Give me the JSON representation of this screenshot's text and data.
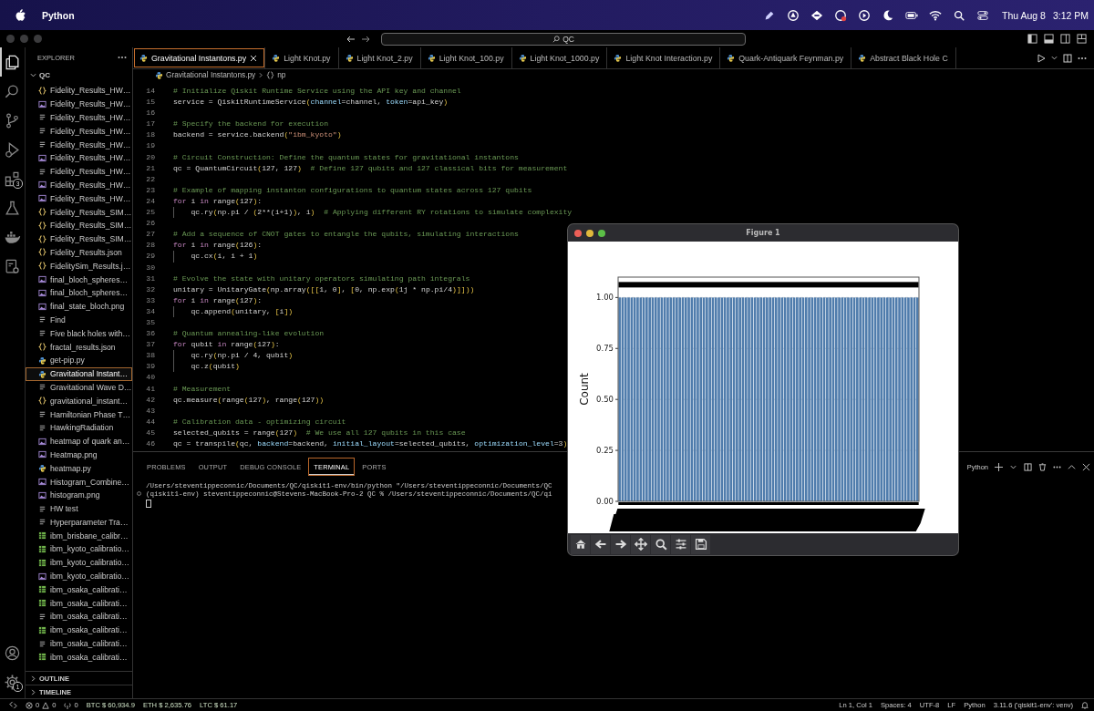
{
  "menubar": {
    "app": "Python",
    "date": "Thu Aug 8",
    "time": "3:12 PM"
  },
  "titlebar": {
    "search": "QC"
  },
  "activity_bar": {
    "items": [
      {
        "kind": "explorer",
        "selected": true
      },
      {
        "kind": "search",
        "selected": false
      },
      {
        "kind": "source_control",
        "selected": false
      },
      {
        "kind": "run",
        "selected": false
      },
      {
        "kind": "extensions",
        "selected": false,
        "badge": "3"
      },
      {
        "kind": "testing",
        "selected": false
      },
      {
        "kind": "docker",
        "selected": false
      },
      {
        "kind": "remote",
        "selected": false
      }
    ],
    "bottom": [
      {
        "kind": "account"
      },
      {
        "kind": "settings",
        "badge": "1"
      }
    ]
  },
  "sidebar": {
    "title": "EXPLORER",
    "folder": "QC",
    "items": [
      {
        "label": "Fidelity_Results_HW…",
        "kind": "json",
        "selected": false
      },
      {
        "label": "Fidelity_Results_HW…",
        "kind": "image",
        "selected": false
      },
      {
        "label": "Fidelity_Results_HW…",
        "kind": "text",
        "selected": false
      },
      {
        "label": "Fidelity_Results_HW…",
        "kind": "text",
        "selected": false
      },
      {
        "label": "Fidelity_Results_HW…",
        "kind": "text",
        "selected": false
      },
      {
        "label": "Fidelity_Results_HW…",
        "kind": "image",
        "selected": false
      },
      {
        "label": "Fidelity_Results_HW…",
        "kind": "text",
        "selected": false
      },
      {
        "label": "Fidelity_Results_HW…",
        "kind": "image",
        "selected": false
      },
      {
        "label": "Fidelity_Results_HW…",
        "kind": "image",
        "selected": false
      },
      {
        "label": "Fidelity_Results_SIM…",
        "kind": "json",
        "selected": false
      },
      {
        "label": "Fidelity_Results_SIM…",
        "kind": "json",
        "selected": false
      },
      {
        "label": "Fidelity_Results_SIM…",
        "kind": "json",
        "selected": false
      },
      {
        "label": "Fidelity_Results.json",
        "kind": "json",
        "selected": false
      },
      {
        "label": "FidelitySim_Results.j…",
        "kind": "json",
        "selected": false
      },
      {
        "label": "final_bloch_spheres…",
        "kind": "image",
        "selected": false
      },
      {
        "label": "final_bloch_spheres…",
        "kind": "image",
        "selected": false
      },
      {
        "label": "final_state_bloch.png",
        "kind": "image",
        "selected": false
      },
      {
        "label": "Find",
        "kind": "text",
        "selected": false
      },
      {
        "label": "Five black holes with…",
        "kind": "text",
        "selected": false
      },
      {
        "label": "fractal_results.json",
        "kind": "json",
        "selected": false
      },
      {
        "label": "get-pip.py",
        "kind": "python",
        "selected": false
      },
      {
        "label": "Gravitational Instant…",
        "kind": "python",
        "selected": true
      },
      {
        "label": "Gravitational Wave D…",
        "kind": "text",
        "selected": false
      },
      {
        "label": "gravitational_instant…",
        "kind": "json",
        "selected": false
      },
      {
        "label": "Hamiltonian Phase T…",
        "kind": "text",
        "selected": false
      },
      {
        "label": "HawkingRadiation",
        "kind": "text",
        "selected": false
      },
      {
        "label": "heatmap of quark an…",
        "kind": "image",
        "selected": false
      },
      {
        "label": "Heatmap.png",
        "kind": "image",
        "selected": false
      },
      {
        "label": "heatmap.py",
        "kind": "python",
        "selected": false
      },
      {
        "label": "Histogram_Combine…",
        "kind": "image",
        "selected": false
      },
      {
        "label": "histogram.png",
        "kind": "image",
        "selected": false
      },
      {
        "label": "HW test",
        "kind": "text",
        "selected": false
      },
      {
        "label": "Hyperparameter Tra…",
        "kind": "text",
        "selected": false
      },
      {
        "label": "ibm_brisbane_calibr…",
        "kind": "table",
        "selected": false
      },
      {
        "label": "ibm_kyoto_calibratio…",
        "kind": "table",
        "selected": false
      },
      {
        "label": "ibm_kyoto_calibratio…",
        "kind": "table",
        "selected": false
      },
      {
        "label": "ibm_kyoto_calibratio…",
        "kind": "image",
        "selected": false
      },
      {
        "label": "ibm_osaka_calibrati…",
        "kind": "table",
        "selected": false
      },
      {
        "label": "ibm_osaka_calibrati…",
        "kind": "table",
        "selected": false
      },
      {
        "label": "ibm_osaka_calibrati…",
        "kind": "text",
        "selected": false
      },
      {
        "label": "ibm_osaka_calibrati…",
        "kind": "table",
        "selected": false
      },
      {
        "label": "ibm_osaka_calibrati…",
        "kind": "text",
        "selected": false
      },
      {
        "label": "ibm_osaka_calibrati…",
        "kind": "table",
        "selected": false
      }
    ],
    "sections": [
      "OUTLINE",
      "TIMELINE"
    ]
  },
  "tabs": [
    {
      "label": "Gravitational Instantons.py",
      "selected": true
    },
    {
      "label": "Light Knot.py",
      "selected": false
    },
    {
      "label": "Light Knot_2.py",
      "selected": false
    },
    {
      "label": "Light Knot_100.py",
      "selected": false
    },
    {
      "label": "Light Knot_1000.py",
      "selected": false
    },
    {
      "label": "Light Knot Interaction.py",
      "selected": false
    },
    {
      "label": "Quark-Antiquark Feynman.py",
      "selected": false
    },
    {
      "label": "Abstract Black Hole C",
      "selected": false
    }
  ],
  "breadcrumb": {
    "file": "Gravitational Instantons.py",
    "symbol": "np"
  },
  "code": {
    "lines": [
      {
        "number": "14",
        "tokens": [
          {
            "text": "# Initialize Qiskit Runtime Service using the API key and channel",
            "kind": "comment"
          }
        ]
      },
      {
        "number": "15",
        "tokens": [
          {
            "text": "service = QiskitRuntimeService",
            "kind": "plain"
          },
          {
            "text": "(",
            "kind": "bracket"
          },
          {
            "text": "channel",
            "kind": "param"
          },
          {
            "text": "=channel, ",
            "kind": "plain"
          },
          {
            "text": "token",
            "kind": "param"
          },
          {
            "text": "=api_key",
            "kind": "plain"
          },
          {
            "text": ")",
            "kind": "bracket"
          }
        ]
      },
      {
        "number": "16"
      },
      {
        "number": "17",
        "tokens": [
          {
            "text": "# Specify the backend for execution",
            "kind": "comment"
          }
        ]
      },
      {
        "number": "18",
        "tokens": [
          {
            "text": "backend = service.backend",
            "kind": "plain"
          },
          {
            "text": "(",
            "kind": "bracket"
          },
          {
            "text": "\"ibm_kyoto\"",
            "kind": "string"
          },
          {
            "text": ")",
            "kind": "bracket"
          }
        ]
      },
      {
        "number": "19"
      },
      {
        "number": "20",
        "tokens": [
          {
            "text": "# Circuit Construction: Define the quantum states for gravitational instantons",
            "kind": "comment"
          }
        ]
      },
      {
        "number": "21",
        "tokens": [
          {
            "text": "qc = QuantumCircuit",
            "kind": "plain"
          },
          {
            "text": "(",
            "kind": "bracket"
          },
          {
            "text": "127, 127",
            "kind": "plain"
          },
          {
            "text": ")",
            "kind": "bracket"
          },
          {
            "text": "  # Define 127 qubits and 127 classical bits for measurement",
            "kind": "comment"
          }
        ]
      },
      {
        "number": "22"
      },
      {
        "number": "23",
        "tokens": [
          {
            "text": "# Example of mapping instanton configurations to quantum states across 127 qubits",
            "kind": "comment"
          }
        ]
      },
      {
        "number": "24",
        "tokens": [
          {
            "text": "for",
            "kind": "keyword"
          },
          {
            "text": " i ",
            "kind": "plain"
          },
          {
            "text": "in",
            "kind": "keyword"
          },
          {
            "text": " range",
            "kind": "plain"
          },
          {
            "text": "(",
            "kind": "bracket"
          },
          {
            "text": "127",
            "kind": "plain"
          },
          {
            "text": ")",
            "kind": "bracket"
          },
          {
            "text": ":",
            "kind": "plain"
          }
        ]
      },
      {
        "number": "25",
        "guide": true,
        "tokens": [
          {
            "text": "    qc.ry",
            "kind": "plain"
          },
          {
            "text": "(",
            "kind": "bracket"
          },
          {
            "text": "np.pi / ",
            "kind": "plain"
          },
          {
            "text": "(",
            "kind": "bracket"
          },
          {
            "text": "2**(i+1)",
            "kind": "plain"
          },
          {
            "text": ")",
            "kind": "bracket"
          },
          {
            "text": ", i",
            "kind": "plain"
          },
          {
            "text": ")",
            "kind": "bracket"
          },
          {
            "text": "  # Applying different RY rotations to simulate complexity",
            "kind": "comment"
          }
        ]
      },
      {
        "number": "26"
      },
      {
        "number": "27",
        "tokens": [
          {
            "text": "# Add a sequence of CNOT gates to entangle the qubits, simulating interactions",
            "kind": "comment"
          }
        ]
      },
      {
        "number": "28",
        "tokens": [
          {
            "text": "for",
            "kind": "keyword"
          },
          {
            "text": " i ",
            "kind": "plain"
          },
          {
            "text": "in",
            "kind": "keyword"
          },
          {
            "text": " range",
            "kind": "plain"
          },
          {
            "text": "(",
            "kind": "bracket"
          },
          {
            "text": "126",
            "kind": "plain"
          },
          {
            "text": ")",
            "kind": "bracket"
          },
          {
            "text": ":",
            "kind": "plain"
          }
        ]
      },
      {
        "number": "29",
        "guide": true,
        "tokens": [
          {
            "text": "    qc.cx",
            "kind": "plain"
          },
          {
            "text": "(",
            "kind": "bracket"
          },
          {
            "text": "i, i + 1",
            "kind": "plain"
          },
          {
            "text": ")",
            "kind": "bracket"
          }
        ]
      },
      {
        "number": "30"
      },
      {
        "number": "31",
        "tokens": [
          {
            "text": "# Evolve the state with unitary operators simulating path integrals",
            "kind": "comment"
          }
        ]
      },
      {
        "number": "32",
        "tokens": [
          {
            "text": "unitary = UnitaryGate",
            "kind": "plain"
          },
          {
            "text": "(",
            "kind": "bracket"
          },
          {
            "text": "np.array",
            "kind": "plain"
          },
          {
            "text": "(",
            "kind": "bracket"
          },
          {
            "text": "[[",
            "kind": "bracket"
          },
          {
            "text": "1, 0",
            "kind": "plain"
          },
          {
            "text": "]",
            "kind": "bracket"
          },
          {
            "text": ", ",
            "kind": "plain"
          },
          {
            "text": "[",
            "kind": "bracket"
          },
          {
            "text": "0, np.exp",
            "kind": "plain"
          },
          {
            "text": "(",
            "kind": "bracket"
          },
          {
            "text": "1j * np.pi/4",
            "kind": "plain"
          },
          {
            "text": ")",
            "kind": "bracket"
          },
          {
            "text": "]]",
            "kind": "bracket"
          },
          {
            "text": "))",
            "kind": "bracket"
          }
        ]
      },
      {
        "number": "33",
        "tokens": [
          {
            "text": "for",
            "kind": "keyword"
          },
          {
            "text": " i ",
            "kind": "plain"
          },
          {
            "text": "in",
            "kind": "keyword"
          },
          {
            "text": " range",
            "kind": "plain"
          },
          {
            "text": "(",
            "kind": "bracket"
          },
          {
            "text": "127",
            "kind": "plain"
          },
          {
            "text": ")",
            "kind": "bracket"
          },
          {
            "text": ":",
            "kind": "plain"
          }
        ]
      },
      {
        "number": "34",
        "guide": true,
        "tokens": [
          {
            "text": "    qc.append",
            "kind": "plain"
          },
          {
            "text": "(",
            "kind": "bracket"
          },
          {
            "text": "unitary, ",
            "kind": "plain"
          },
          {
            "text": "[",
            "kind": "bracket"
          },
          {
            "text": "i",
            "kind": "plain"
          },
          {
            "text": "])",
            "kind": "bracket"
          }
        ]
      },
      {
        "number": "35"
      },
      {
        "number": "36",
        "tokens": [
          {
            "text": "# Quantum annealing-like evolution",
            "kind": "comment"
          }
        ]
      },
      {
        "number": "37",
        "tokens": [
          {
            "text": "for",
            "kind": "keyword"
          },
          {
            "text": " qubit ",
            "kind": "plain"
          },
          {
            "text": "in",
            "kind": "keyword"
          },
          {
            "text": " range",
            "kind": "plain"
          },
          {
            "text": "(",
            "kind": "bracket"
          },
          {
            "text": "127",
            "kind": "plain"
          },
          {
            "text": ")",
            "kind": "bracket"
          },
          {
            "text": ":",
            "kind": "plain"
          }
        ]
      },
      {
        "number": "38",
        "guide": true,
        "tokens": [
          {
            "text": "    qc.ry",
            "kind": "plain"
          },
          {
            "text": "(",
            "kind": "bracket"
          },
          {
            "text": "np.pi / 4, qubit",
            "kind": "plain"
          },
          {
            "text": ")",
            "kind": "bracket"
          }
        ]
      },
      {
        "number": "39",
        "guide": true,
        "tokens": [
          {
            "text": "    qc.z",
            "kind": "plain"
          },
          {
            "text": "(",
            "kind": "bracket"
          },
          {
            "text": "qubit",
            "kind": "plain"
          },
          {
            "text": ")",
            "kind": "bracket"
          }
        ]
      },
      {
        "number": "40"
      },
      {
        "number": "41",
        "tokens": [
          {
            "text": "# Measurement",
            "kind": "comment"
          }
        ]
      },
      {
        "number": "42",
        "tokens": [
          {
            "text": "qc.measure",
            "kind": "plain"
          },
          {
            "text": "(",
            "kind": "bracket"
          },
          {
            "text": "range",
            "kind": "plain"
          },
          {
            "text": "(",
            "kind": "bracket"
          },
          {
            "text": "127",
            "kind": "plain"
          },
          {
            "text": ")",
            "kind": "bracket"
          },
          {
            "text": ", range",
            "kind": "plain"
          },
          {
            "text": "(",
            "kind": "bracket"
          },
          {
            "text": "127",
            "kind": "plain"
          },
          {
            "text": "))",
            "kind": "bracket"
          }
        ]
      },
      {
        "number": "43"
      },
      {
        "number": "44",
        "tokens": [
          {
            "text": "# Calibration data - optimizing circuit",
            "kind": "comment"
          }
        ]
      },
      {
        "number": "45",
        "tokens": [
          {
            "text": "selected_qubits = range",
            "kind": "plain"
          },
          {
            "text": "(",
            "kind": "bracket"
          },
          {
            "text": "127",
            "kind": "plain"
          },
          {
            "text": ")",
            "kind": "bracket"
          },
          {
            "text": "  # We use all 127 qubits in this case",
            "kind": "comment"
          }
        ]
      },
      {
        "number": "46",
        "tokens": [
          {
            "text": "qc = transpile",
            "kind": "plain"
          },
          {
            "text": "(",
            "kind": "bracket"
          },
          {
            "text": "qc, ",
            "kind": "plain"
          },
          {
            "text": "backend",
            "kind": "param"
          },
          {
            "text": "=backend, ",
            "kind": "plain"
          },
          {
            "text": "initial_layout",
            "kind": "param"
          },
          {
            "text": "=selected_qubits, ",
            "kind": "plain"
          },
          {
            "text": "optimization_level",
            "kind": "param"
          },
          {
            "text": "=3",
            "kind": "plain"
          },
          {
            "text": ")",
            "kind": "bracket"
          }
        ]
      }
    ]
  },
  "panel": {
    "tabs": [
      {
        "label": "PROBLEMS",
        "selected": false
      },
      {
        "label": "OUTPUT",
        "selected": false
      },
      {
        "label": "DEBUG CONSOLE",
        "selected": false
      },
      {
        "label": "TERMINAL",
        "selected": true
      },
      {
        "label": "PORTS",
        "selected": false
      }
    ],
    "shell": "Python",
    "terminal": [
      {
        "text": "/Users/steventippeconnic/Documents/QC/qiskit1-env/bin/python \"/Users/steventippeconnic/Documents/QC"
      },
      {
        "text": "(qiskit1-env) steventippeconnic@Stevens-MacBook-Pro-2 QC % /Users/steventippeconnic/Documents/QC/qi",
        "decorated": true
      }
    ]
  },
  "figure": {
    "title": "Figure 1",
    "chart_data": {
      "type": "bar",
      "ylabel": "Count",
      "ylim": [
        0,
        1.1
      ],
      "grid": true,
      "yticks": [
        {
          "value": 0,
          "label": "0.00"
        },
        {
          "value": 0.25,
          "label": "0.25"
        },
        {
          "value": 0.5,
          "label": "0.50"
        },
        {
          "value": 0.75,
          "label": "0.75"
        },
        {
          "value": 1,
          "label": "1.00"
        }
      ],
      "values": [
        1,
        1,
        1,
        1,
        1,
        1,
        1,
        1,
        1,
        1,
        1,
        1,
        1,
        1,
        1,
        1,
        1,
        1,
        1,
        1,
        1,
        1,
        1,
        1,
        1,
        1,
        1,
        1,
        1,
        1,
        1,
        1,
        1,
        1,
        1,
        1,
        1,
        1,
        1,
        1,
        1,
        1,
        1,
        1,
        1,
        1,
        1,
        1,
        1,
        1,
        1,
        1,
        1,
        1,
        1,
        1,
        1,
        1,
        1,
        1,
        1,
        1,
        1,
        1,
        1,
        1,
        1,
        1,
        1,
        1,
        1,
        1,
        1,
        1,
        1,
        1,
        1,
        1,
        1,
        1,
        1,
        1,
        1,
        1,
        1,
        1,
        1,
        1,
        1,
        1,
        1,
        1,
        1,
        1,
        1,
        1,
        1,
        1,
        1,
        1
      ]
    }
  },
  "status_bar": {
    "errors": "0",
    "warnings": "0",
    "ports": "0",
    "tickers": [
      "BTC $ 60,934.9",
      "ETH $ 2,635.76",
      "LTC $ 61.17"
    ],
    "right": [
      "Ln 1, Col 1",
      "Spaces: 4",
      "UTF-8",
      "LF",
      "Python",
      "3.11.6 ('qiskit1-env': venv)"
    ]
  }
}
